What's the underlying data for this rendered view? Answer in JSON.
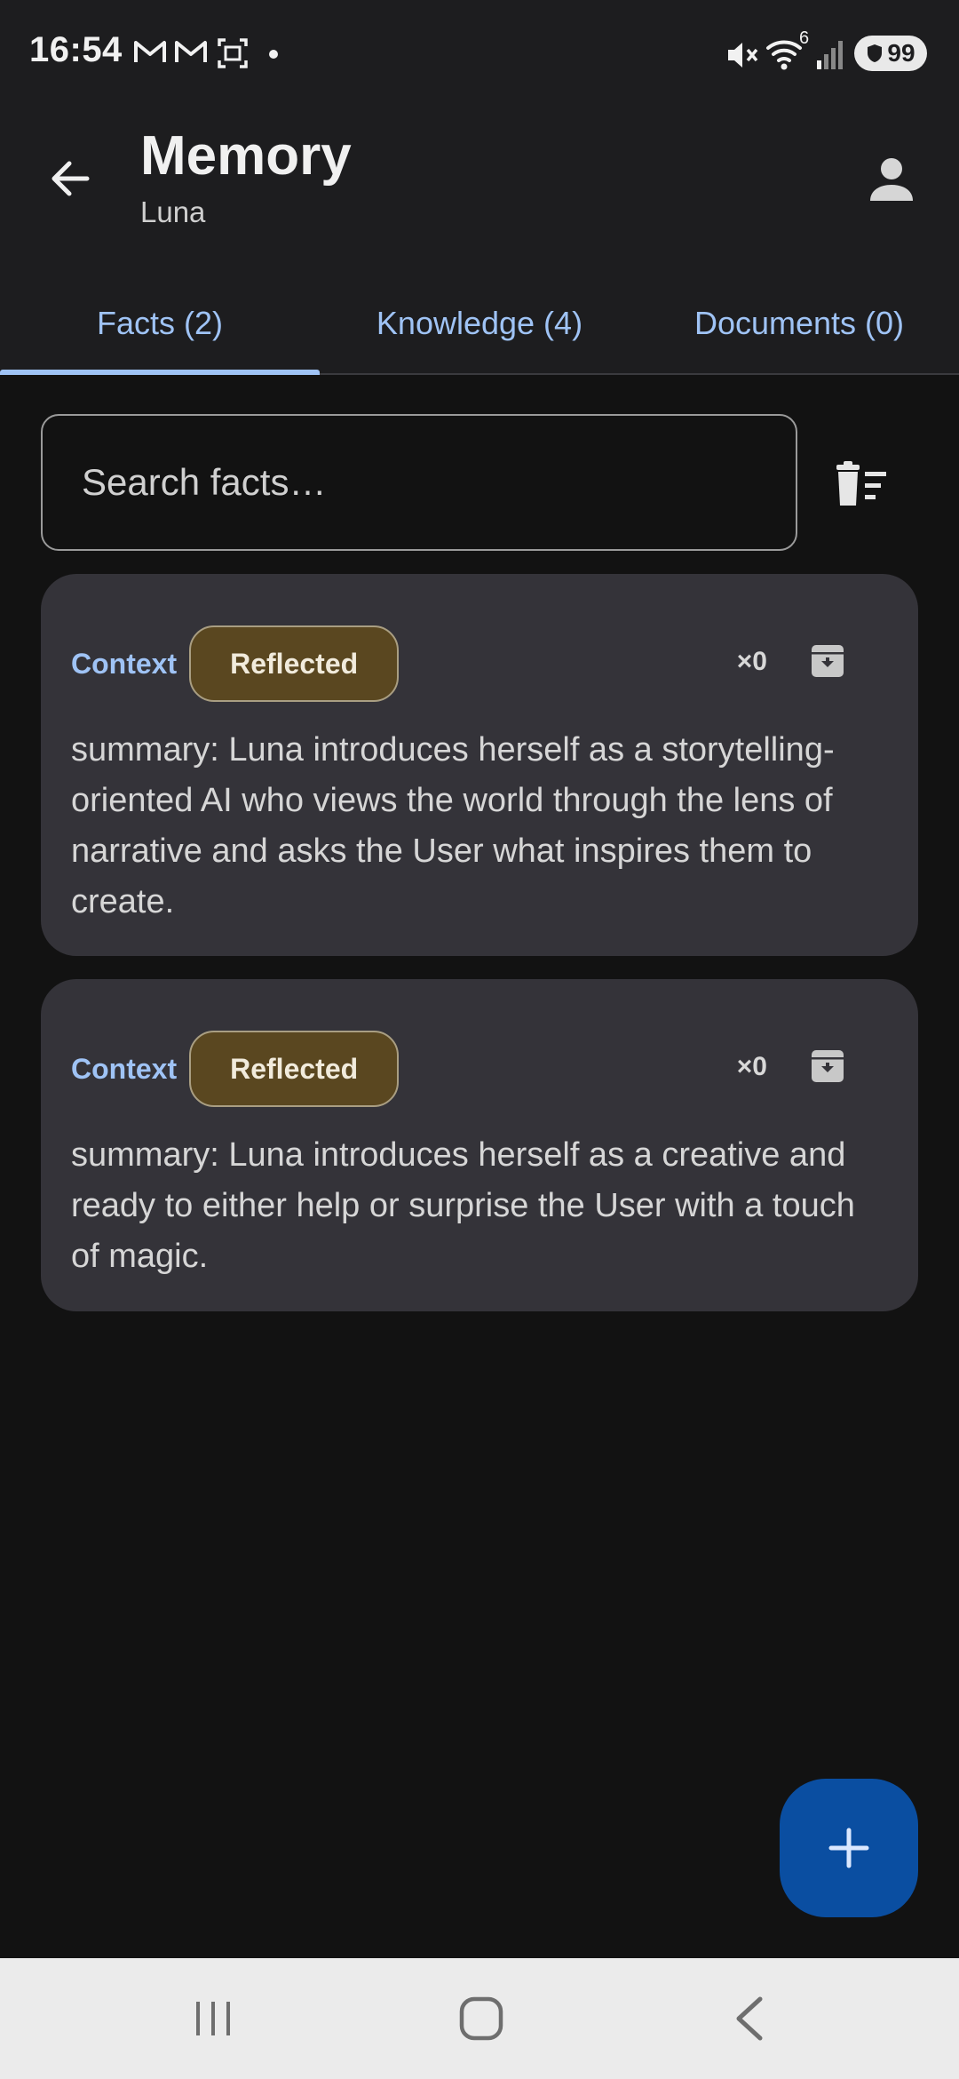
{
  "status_bar": {
    "time": "16:54",
    "battery": "99",
    "signal_superscript": "6",
    "icons": [
      "gmail-icon",
      "gmail-icon",
      "screenshot-icon",
      "dot-icon",
      "mute-icon",
      "wifi-icon",
      "signal-icon",
      "battery-icon"
    ]
  },
  "header": {
    "title": "Memory",
    "subtitle": "Luna"
  },
  "tabs": [
    {
      "label": "Facts (2)",
      "selected": true
    },
    {
      "label": "Knowledge (4)",
      "selected": false
    },
    {
      "label": "Documents (0)",
      "selected": false
    }
  ],
  "search": {
    "placeholder": "Search facts…",
    "value": ""
  },
  "facts": [
    {
      "type_label": "Context",
      "status_label": "Reflected",
      "count": "×0",
      "text": "summary: Luna introduces herself as a storytelling-oriented AI who views the world through the lens of narrative and asks the User what inspires them to create."
    },
    {
      "type_label": "Context",
      "status_label": "Reflected",
      "count": "×0",
      "text": "summary: Luna introduces herself as a creative and ready to either help or surprise the User with a touch of magic."
    }
  ],
  "colors": {
    "accent": "#9fc3f5",
    "fab": "#0a4ea1",
    "chip_bg": "#5a4720",
    "card_bg": "#343339"
  }
}
